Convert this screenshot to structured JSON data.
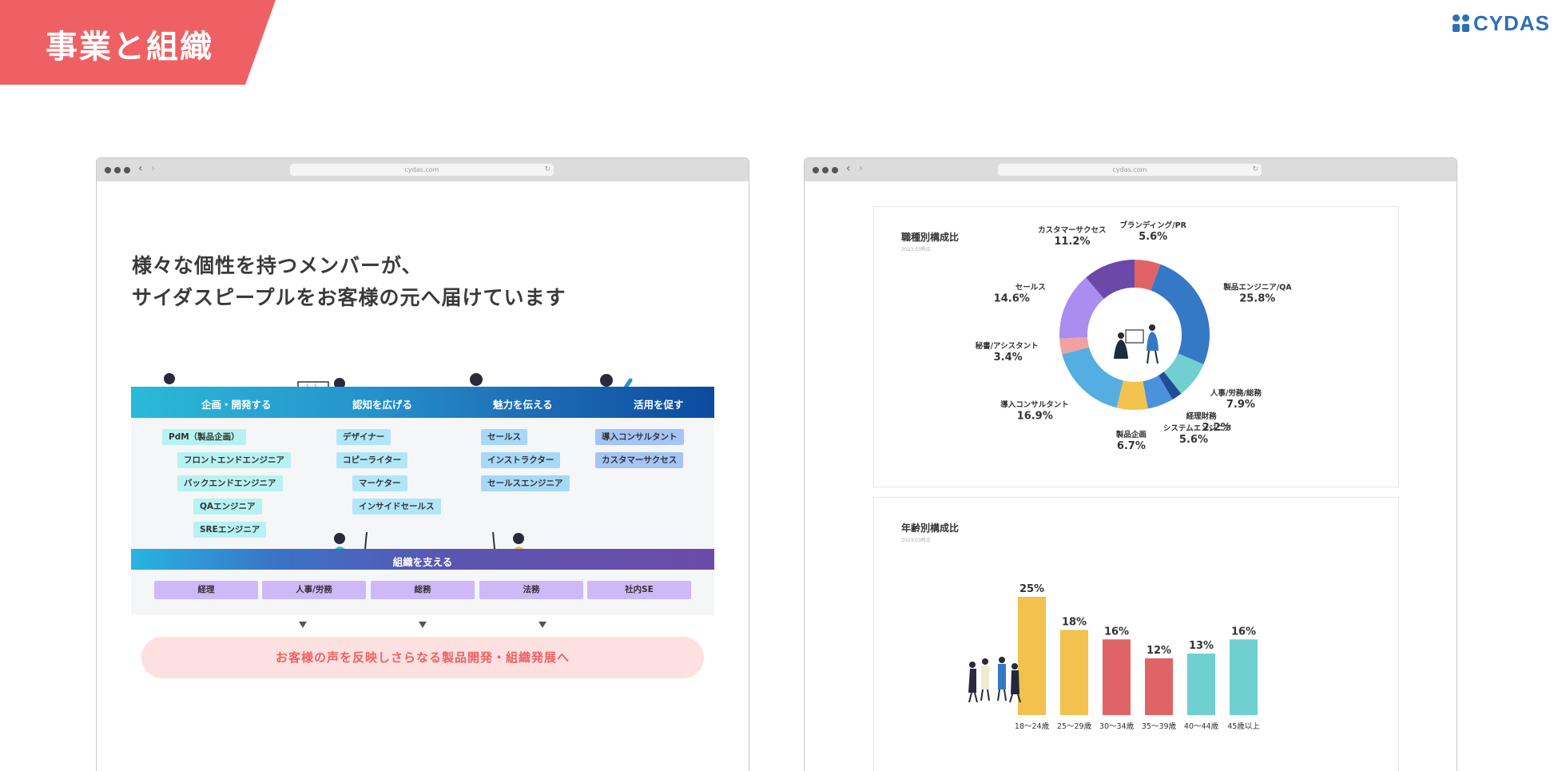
{
  "header": {
    "title": "事業と組織",
    "logo_text": "CYDAS"
  },
  "browser_left": {
    "url": "cydas.com",
    "heading_line1": "様々な個性を持つメンバーが、",
    "heading_line2": "サイダスピープルをお客様の元へ届けています",
    "stages": [
      "企画・開発する",
      "認知を広げる",
      "魅力を伝える",
      "活用を促す"
    ],
    "roles": {
      "plan": [
        "PdM（製品企画）",
        "フロントエンドエンジニア",
        "バックエンドエンジニア",
        "QAエンジニア",
        "SREエンジニア"
      ],
      "awareness": [
        "デザイナー",
        "コピーライター",
        "マーケター",
        "インサイドセールス"
      ],
      "appeal": [
        "セールス",
        "インストラクター",
        "セールスエンジニア"
      ],
      "utilize": [
        "導入コンサルタント",
        "カスタマーサクセス"
      ]
    },
    "support_label": "組織を支える",
    "support_roles": [
      "経理",
      "人事/労務",
      "総務",
      "法務",
      "社内SE"
    ],
    "footer_text": "お客様の声を反映しさらなる製品開発・組織発展へ"
  },
  "browser_right": {
    "url": "cydas.com",
    "job_chart_title": "職種別構成比",
    "job_chart_date": "2023.03時点",
    "age_chart_title": "年齢別構成比",
    "age_chart_date": "2023.03時点"
  },
  "colors": {
    "accent": "#ef6064",
    "brand": "#2d6fb9"
  },
  "chart_data": [
    {
      "type": "pie",
      "title": "職種別構成比",
      "series": [
        {
          "label": "ブランディング/PR",
          "value": 5.6,
          "color": "#e06466"
        },
        {
          "label": "製品エンジニア/QA",
          "value": 25.8,
          "color": "#3478c6"
        },
        {
          "label": "人事/労務/総務",
          "value": 7.9,
          "color": "#6fcfd1"
        },
        {
          "label": "経理財務",
          "value": 2.2,
          "color": "#1f4e96"
        },
        {
          "label": "システムエンジニア",
          "value": 5.6,
          "color": "#4b92dc"
        },
        {
          "label": "製品企画",
          "value": 6.7,
          "color": "#f2c14e"
        },
        {
          "label": "導入コンサルタント",
          "value": 16.9,
          "color": "#55aee2"
        },
        {
          "label": "秘書/アシスタント",
          "value": 3.4,
          "color": "#f0a1a1"
        },
        {
          "label": "セールス",
          "value": 14.6,
          "color": "#a98ef0"
        },
        {
          "label": "カスタマーサクセス",
          "value": 11.2,
          "color": "#6a49a9"
        }
      ]
    },
    {
      "type": "bar",
      "title": "年齢別構成比",
      "categories": [
        "18〜24歳",
        "25〜29歳",
        "30〜34歳",
        "35〜39歳",
        "40〜44歳",
        "45歳以上"
      ],
      "values": [
        25,
        18,
        16,
        12,
        13,
        16
      ],
      "value_labels": [
        "25%",
        "18%",
        "16%",
        "12%",
        "13%",
        "16%"
      ],
      "colors": [
        "#f2c14e",
        "#f2c14e",
        "#e06466",
        "#e06466",
        "#6fcfd1",
        "#6fcfd1"
      ],
      "ylim": [
        0,
        25
      ]
    }
  ]
}
